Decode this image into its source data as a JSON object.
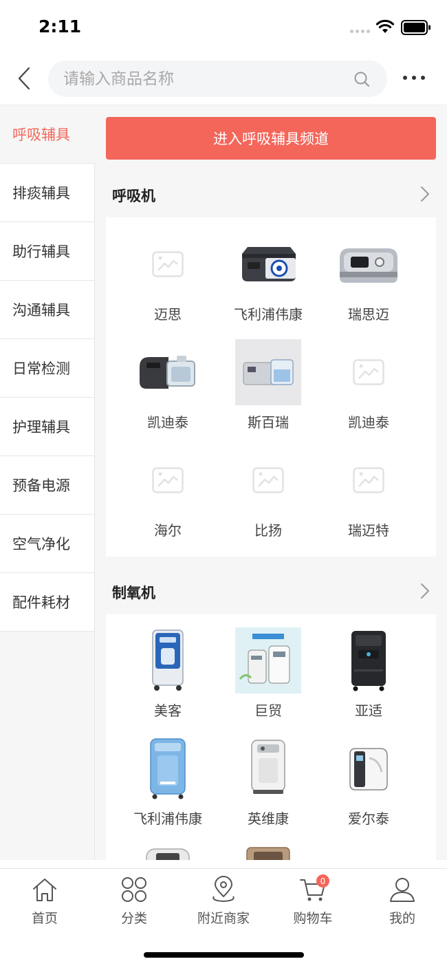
{
  "status_bar": {
    "time": "2:11"
  },
  "search": {
    "placeholder": "请输入商品名称"
  },
  "sidebar": {
    "items": [
      {
        "label": "呼吸辅具",
        "active": true
      },
      {
        "label": "排痰辅具"
      },
      {
        "label": "助行辅具"
      },
      {
        "label": "沟通辅具"
      },
      {
        "label": "日常检测"
      },
      {
        "label": "护理辅具"
      },
      {
        "label": "预备电源"
      },
      {
        "label": "空气净化"
      },
      {
        "label": "配件耗材"
      }
    ]
  },
  "main": {
    "channel_button": "进入呼吸辅具频道",
    "sections": [
      {
        "title": "呼吸机",
        "items": [
          {
            "label": "迈思",
            "image": "placeholder-image-icon"
          },
          {
            "label": "飞利浦伟康",
            "image": "cpap-device-dark"
          },
          {
            "label": "瑞思迈",
            "image": "cpap-device-silver"
          },
          {
            "label": "凯迪泰",
            "image": "cpap-device-humidifier"
          },
          {
            "label": "斯百瑞",
            "image": "cpap-device-gray"
          },
          {
            "label": "凯迪泰",
            "image": "placeholder-image-icon"
          },
          {
            "label": "海尔",
            "image": "placeholder-image-icon"
          },
          {
            "label": "比扬",
            "image": "placeholder-image-icon"
          },
          {
            "label": "瑞迈特",
            "image": "placeholder-image-icon"
          }
        ]
      },
      {
        "title": "制氧机",
        "items": [
          {
            "label": "美客",
            "image": "oxygen-concentrator-blue"
          },
          {
            "label": "巨贸",
            "image": "oxygen-concentrator-poster"
          },
          {
            "label": "亚适",
            "image": "oxygen-concentrator-black"
          },
          {
            "label": "飞利浦伟康",
            "image": "oxygen-concentrator-lightblue"
          },
          {
            "label": "英维康",
            "image": "oxygen-concentrator-white"
          },
          {
            "label": "爱尔泰",
            "image": "oxygen-concentrator-portable"
          }
        ]
      }
    ]
  },
  "tab_bar": {
    "items": [
      {
        "label": "首页",
        "icon": "home-icon"
      },
      {
        "label": "分类",
        "icon": "category-icon"
      },
      {
        "label": "附近商家",
        "icon": "location-icon"
      },
      {
        "label": "购物车",
        "icon": "cart-icon"
      },
      {
        "label": "我的",
        "icon": "user-icon"
      }
    ],
    "cart_badge": "0"
  },
  "colors": {
    "accent": "#f4665a",
    "background": "#f6f6f6"
  }
}
